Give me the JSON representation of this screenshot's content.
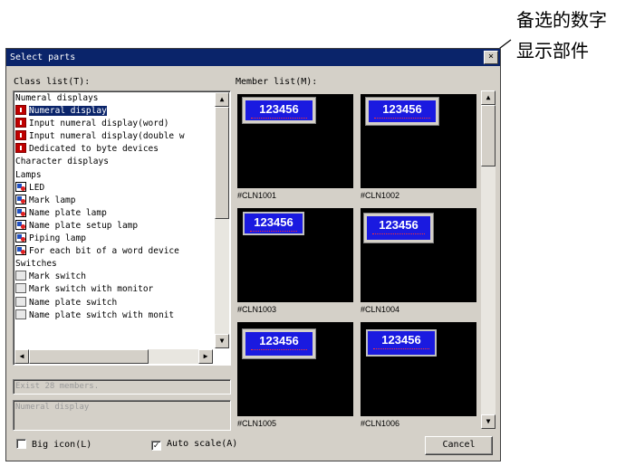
{
  "annotation": {
    "line1": "备选的数字",
    "line2": "显示部件"
  },
  "dialog": {
    "title": "Select parts",
    "close_glyph": "×"
  },
  "class_list": {
    "label": "Class list(T):",
    "items": [
      {
        "text": "Numeral displays",
        "icon": "",
        "selected": false
      },
      {
        "text": "Numeral display",
        "icon": "numeral-icon",
        "selected": true
      },
      {
        "text": "Input numeral display(word)",
        "icon": "numeral-icon",
        "selected": false
      },
      {
        "text": "Input numeral display(double w",
        "icon": "numeral-icon",
        "selected": false
      },
      {
        "text": "Dedicated to byte devices",
        "icon": "numeral-icon",
        "selected": false
      },
      {
        "text": "Character displays",
        "icon": "",
        "selected": false
      },
      {
        "text": "Lamps",
        "icon": "",
        "selected": false
      },
      {
        "text": "LED",
        "icon": "lamp-icon",
        "selected": false
      },
      {
        "text": "Mark lamp",
        "icon": "lamp-icon",
        "selected": false
      },
      {
        "text": "Name plate lamp",
        "icon": "lamp-icon",
        "selected": false
      },
      {
        "text": "Name plate setup lamp",
        "icon": "lamp-icon",
        "selected": false
      },
      {
        "text": "Piping lamp",
        "icon": "lamp-icon",
        "selected": false
      },
      {
        "text": "For each bit of a word device",
        "icon": "lamp-icon",
        "selected": false
      },
      {
        "text": "Switches",
        "icon": "",
        "selected": false
      },
      {
        "text": "Mark switch",
        "icon": "switch-icon",
        "selected": false
      },
      {
        "text": "Mark switch with monitor",
        "icon": "switch-icon",
        "selected": false
      },
      {
        "text": "Name plate switch",
        "icon": "switch-icon",
        "selected": false
      },
      {
        "text": "Name plate switch with monit",
        "icon": "switch-icon",
        "selected": false
      }
    ]
  },
  "info": {
    "members": "Exist 28 members.",
    "description": "Numeral display"
  },
  "member_list": {
    "label": "Member list(M):",
    "value_text": "123456",
    "members": [
      "#CLN1001",
      "#CLN1002",
      "#CLN1003",
      "#CLN1004",
      "#CLN1005",
      "#CLN1006"
    ]
  },
  "options": {
    "big_icon": {
      "label": "Big icon(L)",
      "checked": false
    },
    "auto_scale": {
      "label": "Auto scale(A)",
      "checked": true
    }
  },
  "buttons": {
    "cancel": "Cancel"
  },
  "colors": {
    "titlebar": "#0a246a",
    "display_blue": "#1a1ae0"
  }
}
